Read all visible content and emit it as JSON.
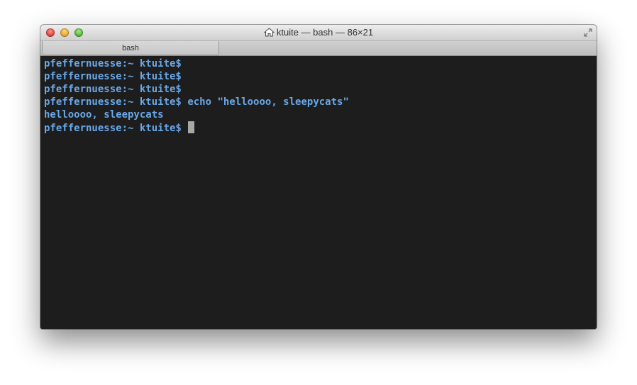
{
  "window": {
    "title": "ktuite — bash — 86×21",
    "title_icon": "home-icon"
  },
  "tabs": [
    {
      "label": "bash"
    }
  ],
  "terminal": {
    "lines": [
      {
        "prompt": "pfeffernuesse:~ ktuite$",
        "command": ""
      },
      {
        "prompt": "pfeffernuesse:~ ktuite$",
        "command": ""
      },
      {
        "prompt": "pfeffernuesse:~ ktuite$",
        "command": ""
      },
      {
        "prompt": "pfeffernuesse:~ ktuite$",
        "command": "echo \"helloooo, sleepycats\""
      },
      {
        "output": "helloooo, sleepycats"
      },
      {
        "prompt": "pfeffernuesse:~ ktuite$",
        "command": ""
      }
    ],
    "text_color": "#6aa8e8",
    "background": "#1d1d1d"
  }
}
